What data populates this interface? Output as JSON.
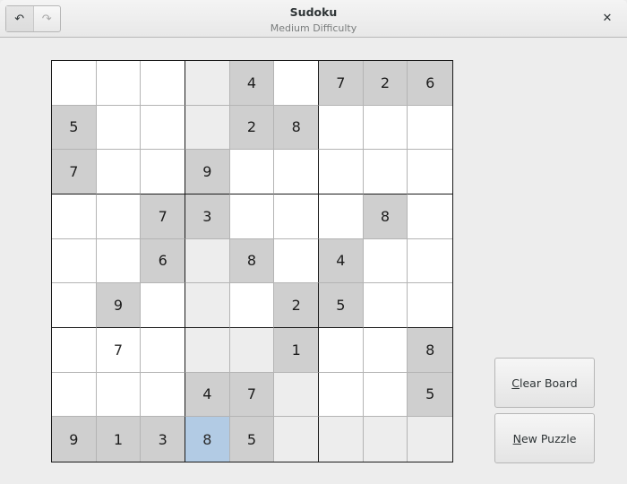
{
  "window": {
    "title": "Sudoku",
    "subtitle": "Medium Difficulty",
    "undo_icon": "undo-arrow-icon",
    "redo_icon": "redo-arrow-icon",
    "close_icon": "close-icon",
    "undo_enabled": true,
    "redo_enabled": false
  },
  "board": {
    "selected": {
      "row": 8,
      "col": 3
    },
    "colors": {
      "fixed": "#cfcfcf",
      "highlight": "#ededed",
      "selected": "#b2cbe4",
      "empty": "#ffffff"
    },
    "cells": [
      [
        {
          "v": ""
        },
        {
          "v": ""
        },
        {
          "v": ""
        },
        {
          "v": ""
        },
        {
          "v": "4",
          "fixed": true
        },
        {
          "v": ""
        },
        {
          "v": "7",
          "fixed": true
        },
        {
          "v": "2",
          "fixed": true
        },
        {
          "v": "6",
          "fixed": true
        }
      ],
      [
        {
          "v": "5",
          "fixed": true
        },
        {
          "v": ""
        },
        {
          "v": ""
        },
        {
          "v": ""
        },
        {
          "v": "2",
          "fixed": true
        },
        {
          "v": "8",
          "fixed": true
        },
        {
          "v": ""
        },
        {
          "v": ""
        },
        {
          "v": ""
        }
      ],
      [
        {
          "v": "7",
          "fixed": true
        },
        {
          "v": ""
        },
        {
          "v": ""
        },
        {
          "v": "9",
          "fixed": true
        },
        {
          "v": ""
        },
        {
          "v": ""
        },
        {
          "v": ""
        },
        {
          "v": ""
        },
        {
          "v": ""
        }
      ],
      [
        {
          "v": ""
        },
        {
          "v": ""
        },
        {
          "v": "7",
          "fixed": true
        },
        {
          "v": "3",
          "fixed": true
        },
        {
          "v": ""
        },
        {
          "v": ""
        },
        {
          "v": ""
        },
        {
          "v": "8",
          "fixed": true
        },
        {
          "v": ""
        }
      ],
      [
        {
          "v": ""
        },
        {
          "v": ""
        },
        {
          "v": "6",
          "fixed": true
        },
        {
          "v": ""
        },
        {
          "v": "8",
          "fixed": true
        },
        {
          "v": ""
        },
        {
          "v": "4",
          "fixed": true
        },
        {
          "v": ""
        },
        {
          "v": ""
        }
      ],
      [
        {
          "v": ""
        },
        {
          "v": "9",
          "fixed": true
        },
        {
          "v": ""
        },
        {
          "v": ""
        },
        {
          "v": ""
        },
        {
          "v": "2",
          "fixed": true
        },
        {
          "v": "5",
          "fixed": true
        },
        {
          "v": ""
        },
        {
          "v": ""
        }
      ],
      [
        {
          "v": ""
        },
        {
          "v": "7"
        },
        {
          "v": ""
        },
        {
          "v": ""
        },
        {
          "v": ""
        },
        {
          "v": "1",
          "fixed": true
        },
        {
          "v": ""
        },
        {
          "v": ""
        },
        {
          "v": "8",
          "fixed": true
        }
      ],
      [
        {
          "v": ""
        },
        {
          "v": ""
        },
        {
          "v": ""
        },
        {
          "v": "4",
          "fixed": true
        },
        {
          "v": "7",
          "fixed": true
        },
        {
          "v": ""
        },
        {
          "v": ""
        },
        {
          "v": ""
        },
        {
          "v": "5",
          "fixed": true
        }
      ],
      [
        {
          "v": "9",
          "fixed": true
        },
        {
          "v": "1",
          "fixed": true
        },
        {
          "v": "3",
          "fixed": true
        },
        {
          "v": "8"
        },
        {
          "v": "5",
          "fixed": true
        },
        {
          "v": ""
        },
        {
          "v": ""
        },
        {
          "v": ""
        },
        {
          "v": ""
        }
      ]
    ]
  },
  "buttons": {
    "clear_board": {
      "mnemonic": "C",
      "rest": "lear Board"
    },
    "new_puzzle": {
      "mnemonic": "N",
      "rest": "ew Puzzle"
    }
  }
}
